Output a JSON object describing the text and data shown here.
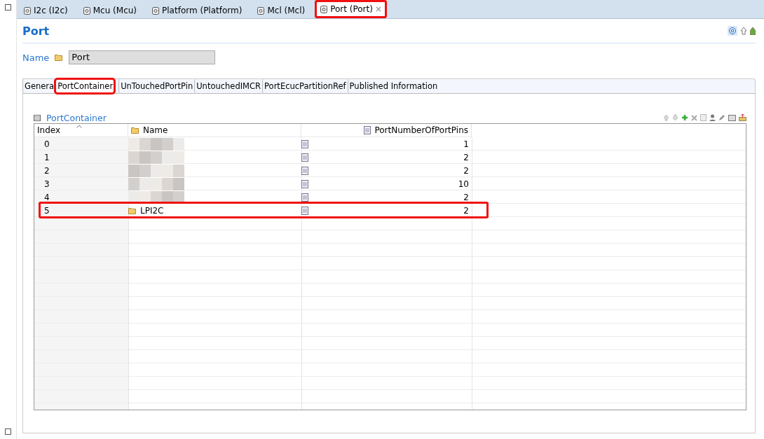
{
  "editor_tabs": [
    {
      "label": "I2c (I2c)",
      "selected": false,
      "highlighted": false
    },
    {
      "label": "Mcu (Mcu)",
      "selected": false,
      "highlighted": false
    },
    {
      "label": "Platform (Platform)",
      "selected": false,
      "highlighted": false
    },
    {
      "label": "Mcl (Mcl)",
      "selected": false,
      "highlighted": false
    },
    {
      "label": "Port (Port)",
      "selected": true,
      "highlighted": true
    }
  ],
  "title": "Port",
  "name_field": {
    "label": "Name",
    "value": "Port"
  },
  "sub_tabs": [
    {
      "label": "Genera",
      "selected": false,
      "highlighted": false
    },
    {
      "label": "PortContainer",
      "selected": true,
      "highlighted": true
    },
    {
      "label": "UnTouchedPortPin",
      "selected": false,
      "highlighted": false
    },
    {
      "label": "UntouchedIMCR",
      "selected": false,
      "highlighted": false
    },
    {
      "label": "PortEcucPartitionRef",
      "selected": false,
      "highlighted": false
    },
    {
      "label": "Published Information",
      "selected": false,
      "highlighted": false
    }
  ],
  "section": {
    "title": "PortContainer"
  },
  "table": {
    "columns": [
      "Index",
      "Name",
      "PortNumberOfPortPins"
    ],
    "rows": [
      {
        "index": "0",
        "value": "1",
        "highlighted": false,
        "redacted": true
      },
      {
        "index": "1",
        "value": "2",
        "highlighted": false,
        "redacted": true
      },
      {
        "index": "2",
        "value": "2",
        "highlighted": false,
        "redacted": true
      },
      {
        "index": "3",
        "value": "10",
        "highlighted": false,
        "redacted": true
      },
      {
        "index": "4",
        "value": "2",
        "highlighted": false,
        "redacted": true
      },
      {
        "index": "5",
        "name": "LPI2C",
        "value": "2",
        "highlighted": true,
        "redacted": false
      }
    ]
  }
}
